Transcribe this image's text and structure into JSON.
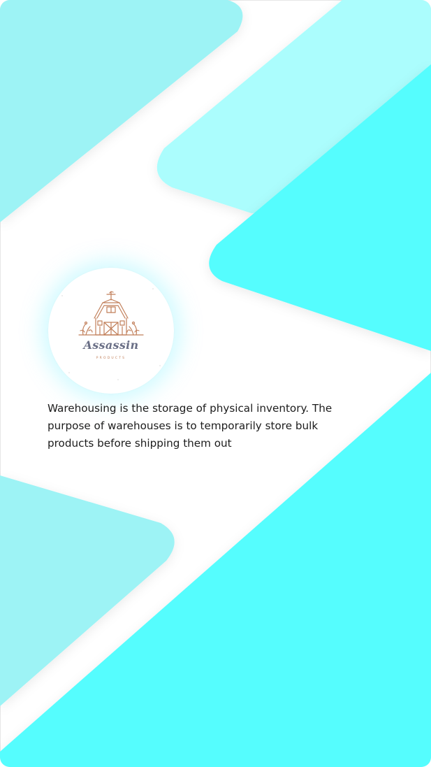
{
  "colors": {
    "background": "#ffffff",
    "shape_light": "#9df3f5",
    "shape_mid": "#abfdfd",
    "shape_accent": "#55fdfe",
    "logo_line": "#c17f5a",
    "logo_text": "#6a6f86",
    "body_text": "#1c1c1c"
  },
  "logo": {
    "icon": "barn-icon",
    "brand": "Assassin",
    "subtitle": "PRODUCTS"
  },
  "description": {
    "text": "Warehousing is the storage of physical inventory. The purpose of warehouses is to temporarily store bulk products before shipping them out"
  }
}
